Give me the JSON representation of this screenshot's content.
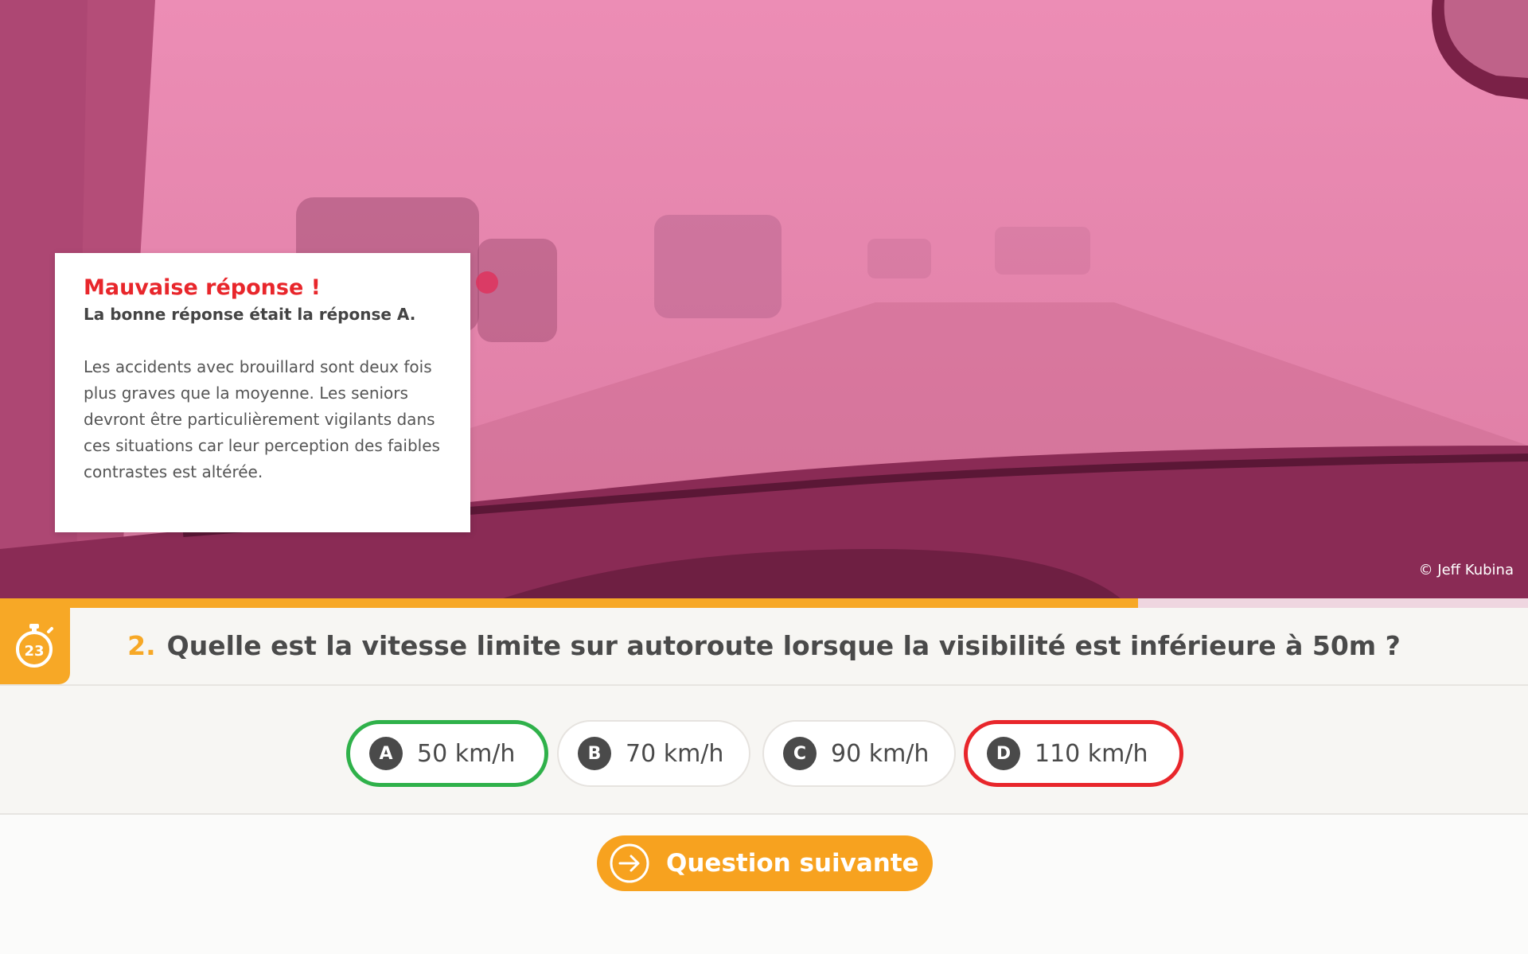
{
  "photo": {
    "credit": "© Jeff Kubina",
    "tint_color": "#ea8cb3"
  },
  "feedback": {
    "title": "Mauvaise réponse !",
    "subtitle": "La bonne réponse était la réponse A.",
    "body": "Les accidents avec brouillard sont deux fois plus graves que la moyenne. Les seniors devront être particulièrement vigilants dans ces situations car leur perception des faibles contrastes est altérée."
  },
  "progress": {
    "fraction": 0.745,
    "color": "#f7a826"
  },
  "timer": {
    "icon": "stopwatch-icon",
    "value": "23"
  },
  "question": {
    "number": "2.",
    "text": "Quelle est la vitesse limite sur autoroute lorsque la visibilité est inférieure à 50m ?"
  },
  "answers": [
    {
      "letter": "A",
      "text": "50 km/h",
      "state": "correct"
    },
    {
      "letter": "B",
      "text": "70 km/h",
      "state": "neutral"
    },
    {
      "letter": "C",
      "text": "90 km/h",
      "state": "neutral"
    },
    {
      "letter": "D",
      "text": "110 km/h",
      "state": "wrong"
    }
  ],
  "colors": {
    "correct": "#2fb14a",
    "wrong": "#e8262b",
    "accent": "#f7a826"
  },
  "next_button": {
    "label": "Question suivante",
    "icon": "arrow-right-circle-icon"
  }
}
